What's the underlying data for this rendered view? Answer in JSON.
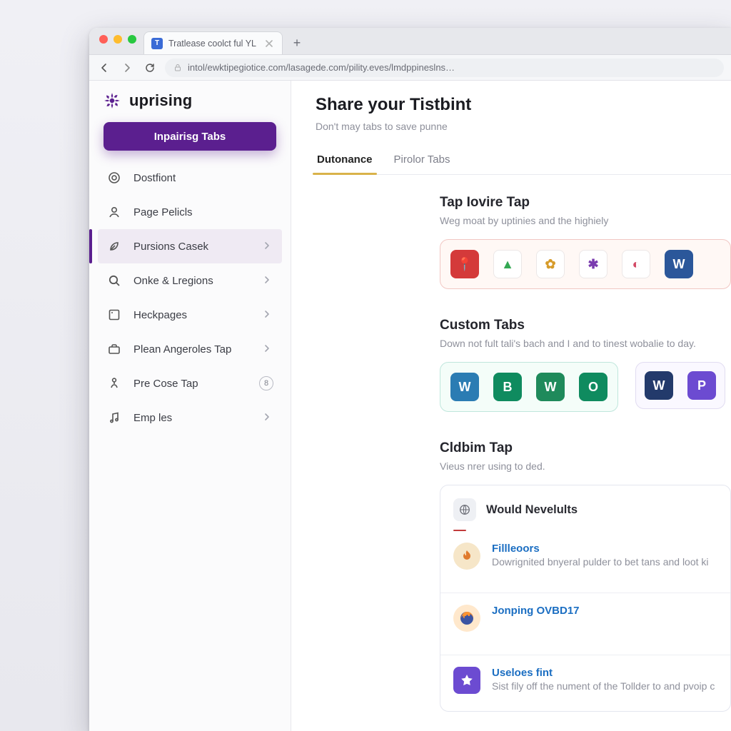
{
  "browser": {
    "tab_title": "Tratlease coolct ful YL",
    "url_display": "intol/ewktipegiotice.com/lasagede.com/pility.eves/lmdppineslns…",
    "new_tab_glyph": "+"
  },
  "sidebar": {
    "brand": "uprising",
    "cta_label": "Inpairisg Tabs",
    "items": [
      {
        "label": "Dostfiont",
        "icon": "target-icon",
        "chevron": false,
        "active": false,
        "badge": null
      },
      {
        "label": "Page Pelicls",
        "icon": "user-icon",
        "chevron": false,
        "active": false,
        "badge": null
      },
      {
        "label": "Pursions Casek",
        "icon": "leaf-icon",
        "chevron": true,
        "active": true,
        "badge": null
      },
      {
        "label": "Onke & Lregions",
        "icon": "search-icon",
        "chevron": true,
        "active": false,
        "badge": null
      },
      {
        "label": "Heckpages",
        "icon": "square-icon",
        "chevron": true,
        "active": false,
        "badge": null
      },
      {
        "label": "Plean Angeroles Tap",
        "icon": "briefcase-icon",
        "chevron": true,
        "active": false,
        "badge": null
      },
      {
        "label": "Pre Cose Tap",
        "icon": "user-tree-icon",
        "chevron": false,
        "active": false,
        "badge": "8"
      },
      {
        "label": "Emp les",
        "icon": "music-icon",
        "chevron": true,
        "active": false,
        "badge": null
      }
    ]
  },
  "header": {
    "title": "Share your Tistbint",
    "subtitle": "Don't may tabs to save punne"
  },
  "tabs": [
    {
      "label": "Dutonance",
      "active": true
    },
    {
      "label": "Pirolor Tabs",
      "active": false
    }
  ],
  "sections": {
    "top": {
      "title": "Tap Iovire Tap",
      "subtitle": "Weg moat by uptinies and the highiely",
      "apps": [
        {
          "name": "pin-icon",
          "glyph": "📍",
          "bg": "#d43a3a",
          "fg": "#fff"
        },
        {
          "name": "drive-icon",
          "glyph": "▲",
          "bg": "#ffffff",
          "fg": "#34a853"
        },
        {
          "name": "clover-icon",
          "glyph": "✿",
          "bg": "#ffffff",
          "fg": "#d69b2a"
        },
        {
          "name": "slack-icon",
          "glyph": "✱",
          "bg": "#ffffff",
          "fg": "#7a3baf"
        },
        {
          "name": "pie-icon",
          "glyph": "◐",
          "bg": "#ffffff",
          "fg": "#d34a66"
        },
        {
          "name": "word-icon",
          "glyph": "W",
          "bg": "#2b579a",
          "fg": "#fff"
        }
      ]
    },
    "custom": {
      "title": "Custom Tabs",
      "subtitle": "Down not fult tali's bach and I and to tinest wobalie to day.",
      "group_apps": [
        {
          "name": "word-icon",
          "glyph": "W",
          "bg": "#2b7cb3",
          "fg": "#fff"
        },
        {
          "name": "bing-icon",
          "glyph": "B",
          "bg": "#0f8b5f",
          "fg": "#fff"
        },
        {
          "name": "excel-icon",
          "glyph": "W",
          "bg": "#1f8a5b",
          "fg": "#fff"
        },
        {
          "name": "onenote-icon",
          "glyph": "O",
          "bg": "#0f8b5f",
          "fg": "#fff"
        }
      ],
      "side_apps": [
        {
          "name": "word-dark-icon",
          "glyph": "W",
          "bg": "#233a6b",
          "fg": "#fff"
        },
        {
          "name": "purple-p-icon",
          "glyph": "P",
          "bg": "#6c4bd1",
          "fg": "#fff"
        }
      ]
    },
    "club": {
      "title": "Cldbim Tap",
      "subtitle": "Vieus nrer using to ded.",
      "card_title": "Would Nevelults",
      "items": [
        {
          "title": "Fillleoors",
          "sub": "Dowrignited bnyeral pulder to bet tans and loot ki",
          "icon": "orange"
        },
        {
          "title": "Jonping OVBD17",
          "sub": "",
          "icon": "ff"
        },
        {
          "title": "Useloes fint",
          "sub": "Sist fily off the nument of the Tollder to and pvoip c",
          "icon": "purple"
        }
      ]
    }
  }
}
